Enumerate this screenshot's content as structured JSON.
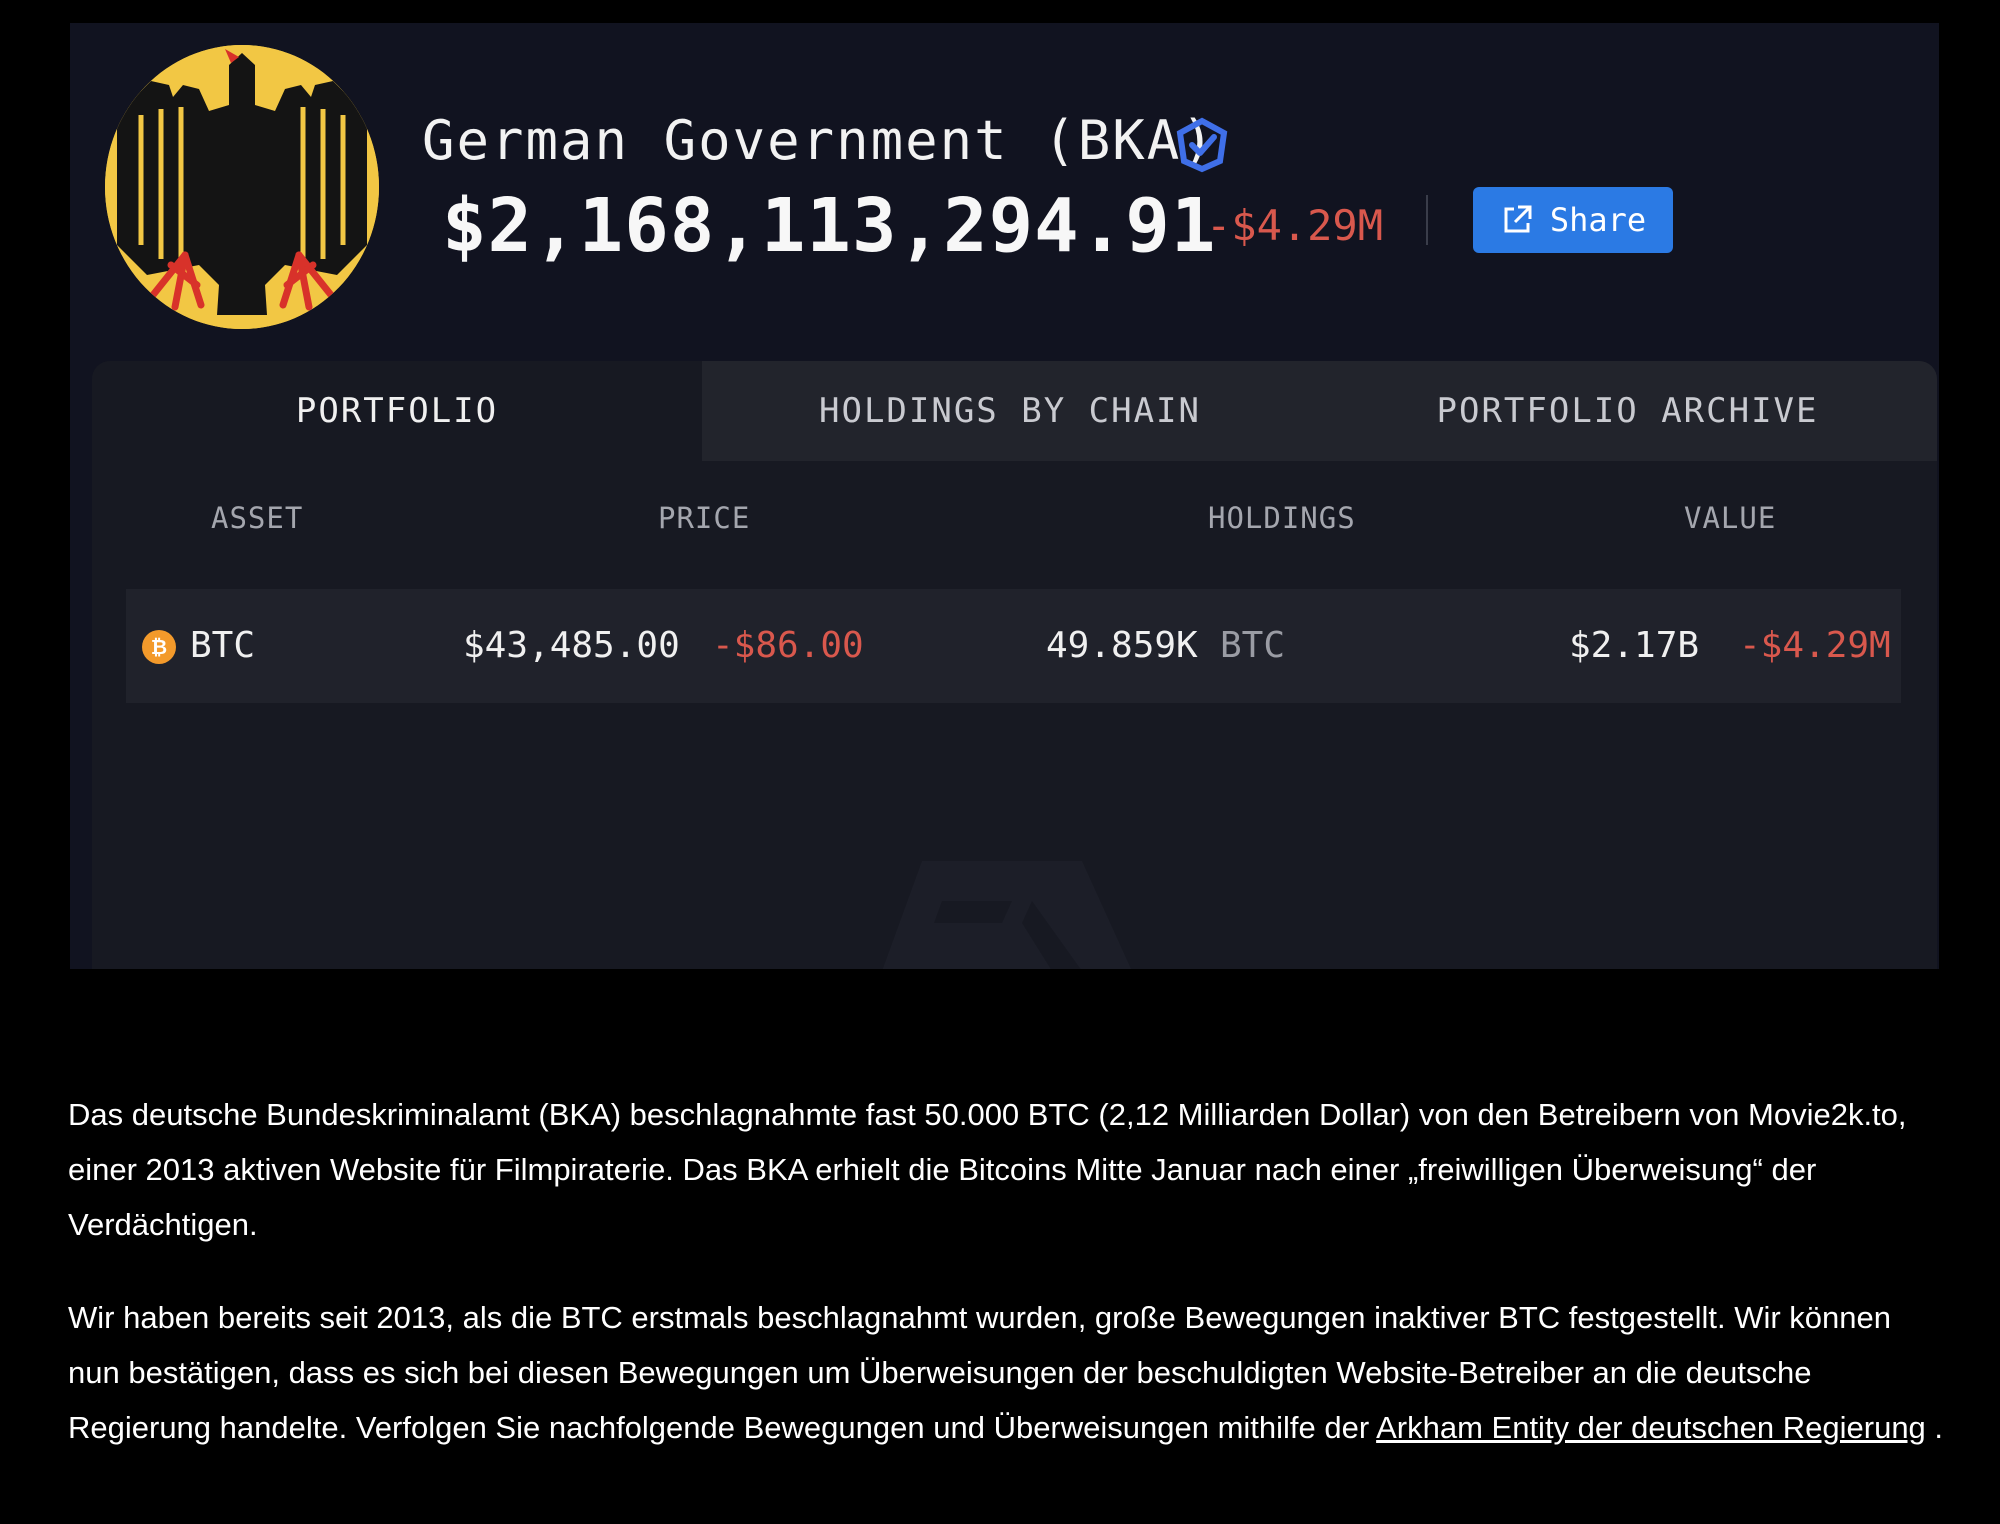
{
  "entity": {
    "name": "German Government (BKA)",
    "logo_icon": "german-eagle-icon",
    "verified_icon": "verified-badge-icon",
    "total_value": "$2,168,113,294.91",
    "total_change": "-$4.29M",
    "share_label": "Share",
    "share_icon": "external-link-icon"
  },
  "tabs": [
    {
      "label": "PORTFOLIO",
      "active": true
    },
    {
      "label": "HOLDINGS BY CHAIN",
      "active": false
    },
    {
      "label": "PORTFOLIO ARCHIVE",
      "active": false
    }
  ],
  "table": {
    "headers": {
      "asset": "ASSET",
      "price": "PRICE",
      "holdings": "HOLDINGS",
      "value": "VALUE"
    },
    "rows": [
      {
        "asset_icon": "bitcoin-icon",
        "asset": "BTC",
        "price": "$43,485.00",
        "price_change": "-$86.00",
        "holdings": "49.859K",
        "holdings_unit": "BTC",
        "value": "$2.17B",
        "value_change": "-$4.29M"
      }
    ]
  },
  "article": {
    "paragraph_1": "Das deutsche Bundeskriminalamt (BKA) beschlagnahmte fast 50.000 BTC (2,12 Milliarden Dollar) von den Betreibern von Movie2k.to, einer 2013 aktiven Website für Filmpiraterie. Das BKA erhielt die Bitcoins Mitte Januar nach einer „freiwilligen Überweisung“ der Verdächtigen.",
    "paragraph_2_text": "Wir haben bereits seit 2013, als die BTC erstmals beschlagnahmt wurden, große Bewegungen inaktiver BTC festgestellt. Wir können nun bestätigen, dass es sich bei diesen Bewegungen um Überweisungen der beschuldigten Website-Betreiber an die deutsche Regierung handelte. Verfolgen Sie nachfolgende Bewegungen und Überweisungen mithilfe der ",
    "paragraph_2_link": "Arkham Entity der deutschen Regierung",
    "paragraph_2_end": " ."
  },
  "colors": {
    "background": "#000000",
    "card": "#111320",
    "negative": "#d9584d",
    "accent": "#2b7ae4",
    "bitcoin": "#f39a2b",
    "eagle_gold": "#f2c744"
  }
}
